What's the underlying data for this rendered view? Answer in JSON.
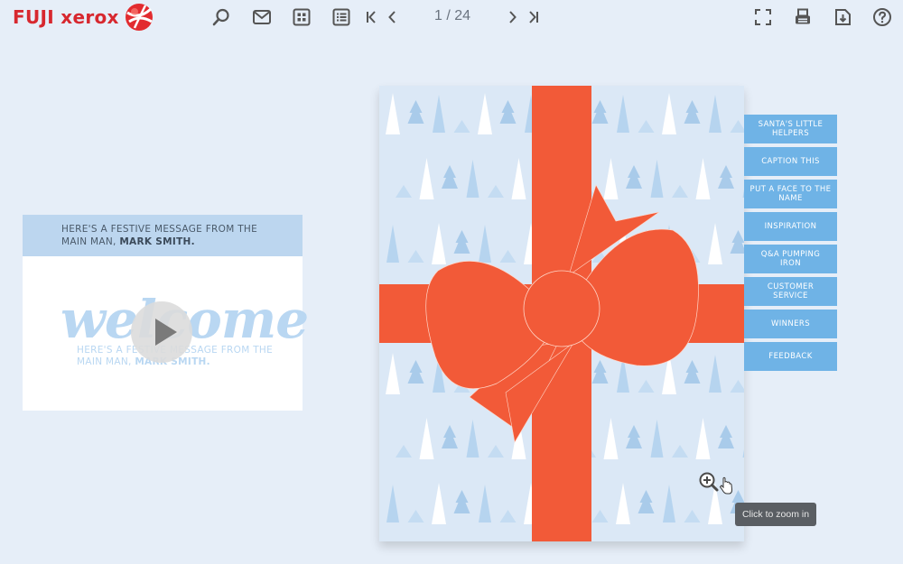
{
  "toolbar": {
    "brand": "FUJI xerox",
    "page_indicator": "1 / 24",
    "buttons": [
      {
        "name": "search-icon"
      },
      {
        "name": "mail-icon"
      },
      {
        "name": "thumbnails-icon"
      },
      {
        "name": "contents-icon"
      },
      {
        "name": "first-page-icon"
      },
      {
        "name": "previous-page-icon"
      },
      {
        "name": "next-page-icon"
      },
      {
        "name": "last-page-icon"
      },
      {
        "name": "fullscreen-icon"
      },
      {
        "name": "print-icon"
      },
      {
        "name": "download-icon"
      },
      {
        "name": "help-icon"
      }
    ]
  },
  "video": {
    "header_line1": "HERE'S A FESTIVE MESSAGE FROM THE",
    "header_line2_prefix": "MAIN MAN, ",
    "header_name": "MARK SMITH.",
    "welcome": "welcome",
    "sub_line1": "HERE'S A FESTIVE MESSAGE FROM THE",
    "sub_line2_prefix": "MAIN MAN, ",
    "sub_name": "MARK SMITH."
  },
  "tabs": [
    "SANTA'S LITTLE HELPERS",
    "CAPTION THIS",
    "PUT A FACE TO THE NAME",
    "INSPIRATION",
    "Q&A PUMPING IRON",
    "CUSTOMER SERVICE",
    "WINNERS",
    "FEEDBACK"
  ],
  "zoom": {
    "tooltip": "Click to zoom in"
  },
  "colors": {
    "background": "#e6eef8",
    "ribbon": "#f25a38",
    "tab": "#6fb3e6",
    "brand_red": "#d7282f"
  }
}
